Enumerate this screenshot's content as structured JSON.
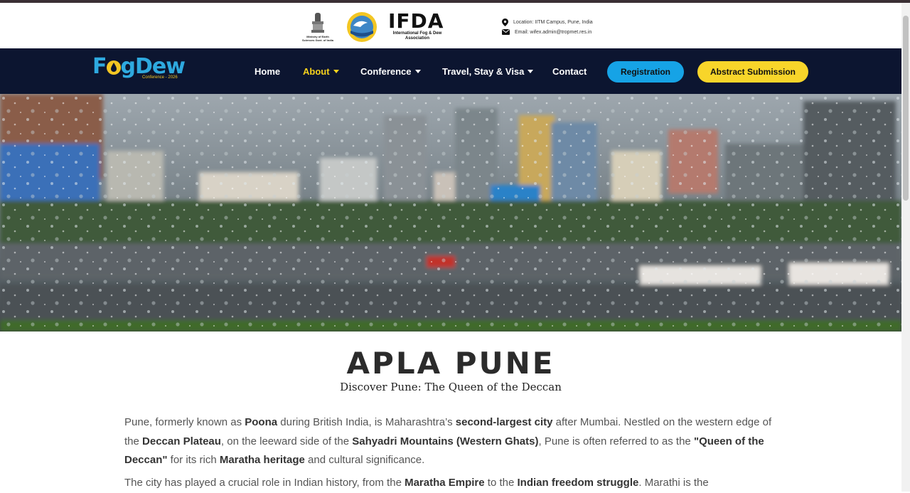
{
  "header": {
    "ministry_text": "Ministry of Earth Sciences Govt. of India",
    "org_title": "IFDA",
    "org_subtitle": "International Fog & Dew Association",
    "location": "Location: IITM Campus, Pune, India",
    "email": "Email: wifex.admin@tropmet.res.in"
  },
  "nav": {
    "brand_left": "F",
    "brand_right": "gDew",
    "brand_sub": "Conference - 2026",
    "items": [
      {
        "label": "Home"
      },
      {
        "label": "About"
      },
      {
        "label": "Conference"
      },
      {
        "label": "Travel, Stay & Visa"
      },
      {
        "label": "Contact"
      }
    ],
    "registration": "Registration",
    "abstract": "Abstract Submission"
  },
  "page": {
    "title": "APLA PUNE",
    "subtitle": "Discover Pune: The Queen of the Deccan",
    "p1": [
      "Pune, formerly known as ",
      "Poona",
      " during British India, is Maharashtra’s ",
      "second-largest city",
      " after Mumbai. Nestled on the western edge of the ",
      "Deccan Plateau",
      ", on the leeward side of the ",
      "Sahyadri Mountains (Western Ghats)",
      ", Pune is often referred to as the ",
      "\"Queen of the Deccan\"",
      " for its rich ",
      "Maratha heritage",
      " and cultural significance."
    ],
    "p2": [
      "The city has played a crucial role in Indian history, from the ",
      "Maratha Empire",
      " to the ",
      "Indian freedom struggle",
      ". Marathi is the"
    ]
  },
  "colors": {
    "navbar": "#0c1530",
    "accent_yellow": "#f8d52a",
    "accent_blue": "#16a3e6",
    "brand_blue": "#2ea9df"
  }
}
